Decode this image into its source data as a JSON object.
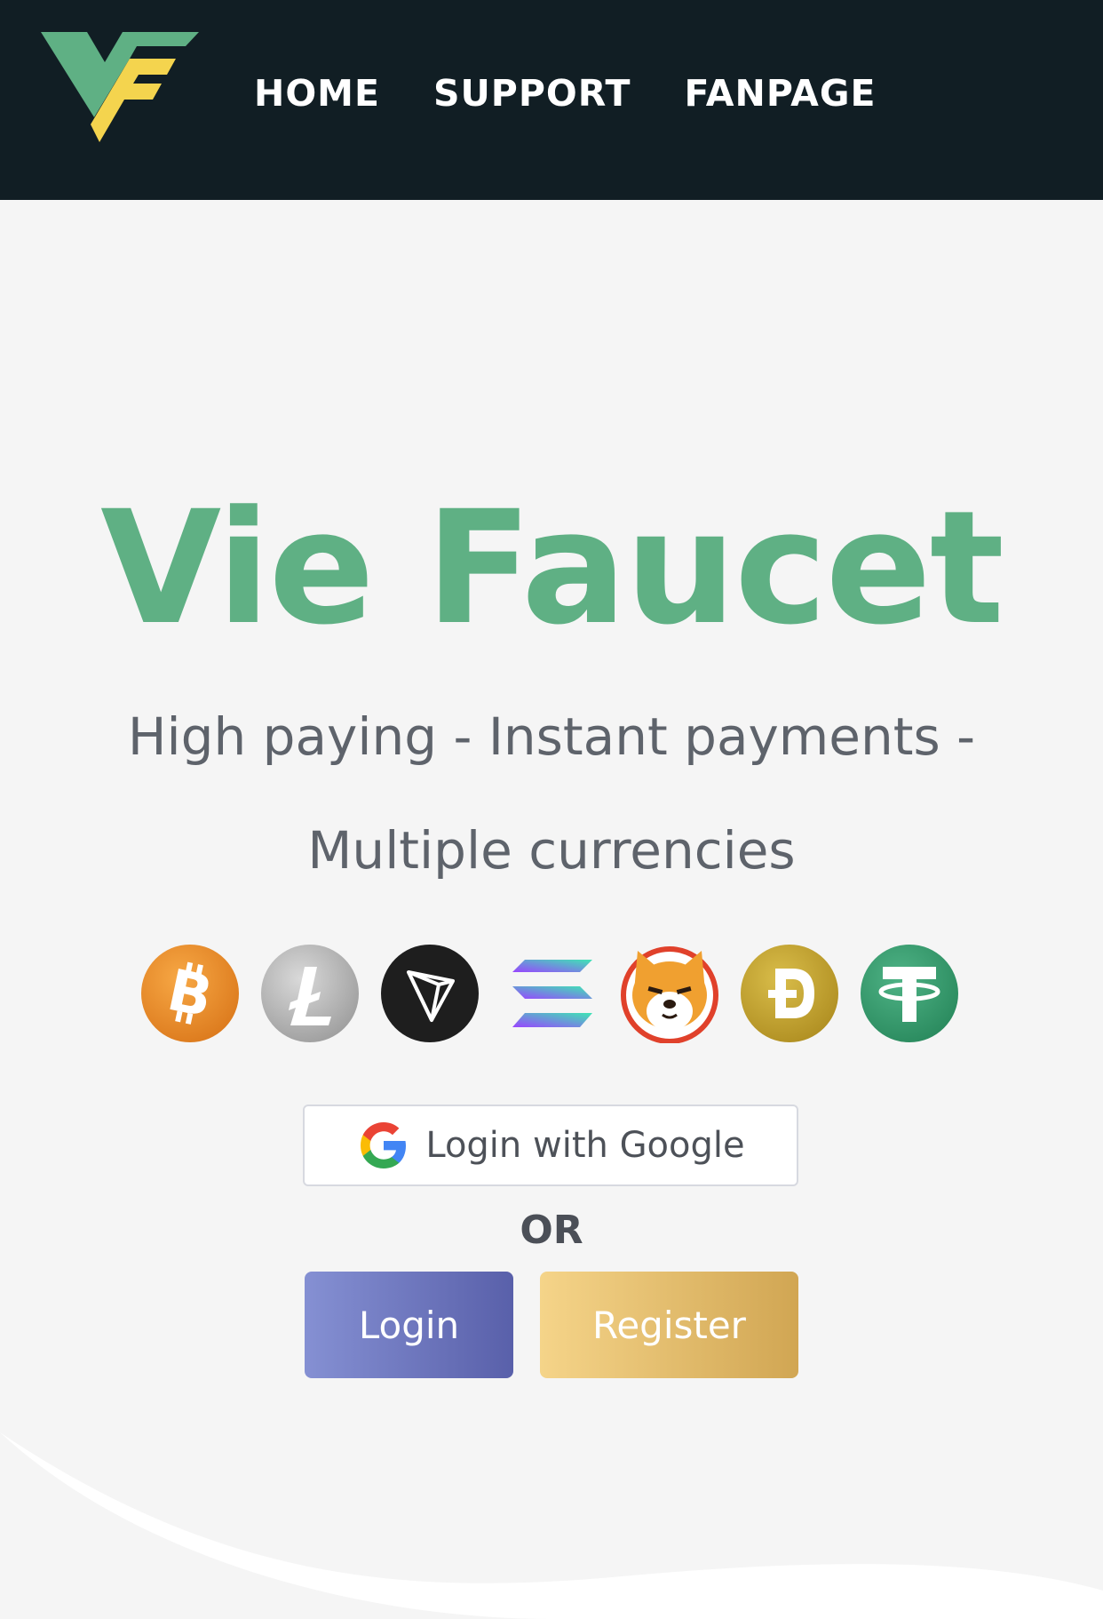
{
  "brand": {
    "logo_icon": "vf-logo-icon",
    "colors": {
      "nav_bg": "#111e24",
      "accent_green": "#5fb084",
      "accent_yellow": "#f4d44e",
      "page_bg": "#f5f5f5"
    }
  },
  "nav": {
    "items": [
      {
        "label": "HOME"
      },
      {
        "label": "SUPPORT"
      },
      {
        "label": "FANPAGE"
      }
    ]
  },
  "hero": {
    "title": "Vie Faucet",
    "tagline": "High paying - Instant payments - Multiple currencies"
  },
  "coins": [
    {
      "icon": "bitcoin-icon",
      "color": "#f0932b"
    },
    {
      "icon": "litecoin-icon",
      "color": "#b8b8b8"
    },
    {
      "icon": "tron-icon",
      "color": "#222222"
    },
    {
      "icon": "solana-icon",
      "color": "#8a5cf0"
    },
    {
      "icon": "shiba-inu-icon",
      "color": "#e0412b"
    },
    {
      "icon": "dogecoin-icon",
      "color": "#c2a633"
    },
    {
      "icon": "tether-icon",
      "color": "#3a9a6f"
    }
  ],
  "auth": {
    "google_label": "Login with Google",
    "or_label": "OR",
    "login_label": "Login",
    "register_label": "Register"
  }
}
